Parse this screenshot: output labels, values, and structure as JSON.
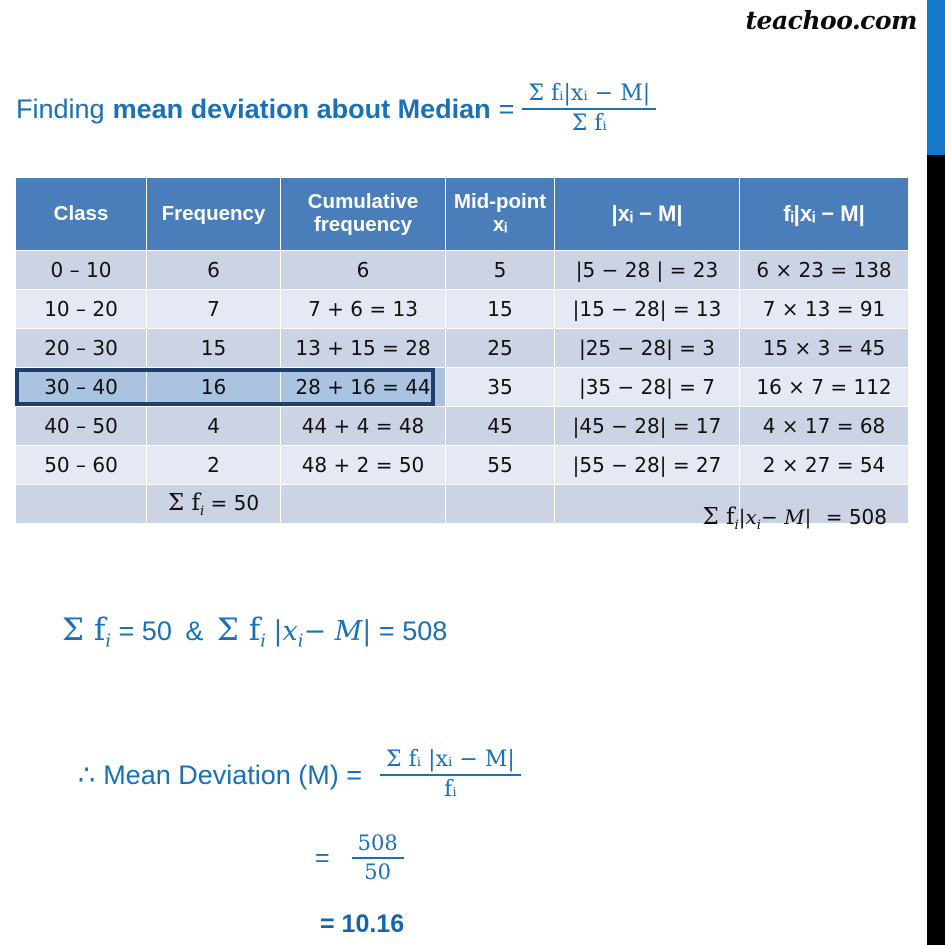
{
  "brand": "teachoo.com",
  "title": {
    "prefix": "Finding",
    "emphasis": "mean deviation about Median",
    "equals": "=",
    "formula_numerator": "Σ fᵢ|xᵢ − M|",
    "formula_denominator": "Σ fᵢ"
  },
  "table": {
    "headers": [
      "Class",
      "Frequency",
      "Cumulative frequency",
      "Mid-point xᵢ",
      "|xᵢ − M|",
      "fᵢ|xᵢ − M|"
    ],
    "rows": [
      {
        "class": "0 – 10",
        "frequency": "6",
        "cumulative": "6",
        "midpoint": "5",
        "deviation": "|5 − 28 | = 23",
        "product": "6 × 23 = 138",
        "highlighted": false
      },
      {
        "class": "10 – 20",
        "frequency": "7",
        "cumulative": "7 + 6 = 13",
        "midpoint": "15",
        "deviation": "|15 − 28| = 13",
        "product": "7 × 13 = 91",
        "highlighted": false
      },
      {
        "class": "20 – 30",
        "frequency": "15",
        "cumulative": "13 + 15 = 28",
        "midpoint": "25",
        "deviation": "|25 − 28| = 3",
        "product": "15 × 3 = 45",
        "highlighted": false
      },
      {
        "class": "30 – 40",
        "frequency": "16",
        "cumulative": "28 + 16 = 44",
        "midpoint": "35",
        "deviation": "|35 − 28| = 7",
        "product": "16   × 7 = 112",
        "highlighted": true
      },
      {
        "class": "40 – 50",
        "frequency": "4",
        "cumulative": "44 + 4 = 48",
        "midpoint": "45",
        "deviation": "|45 − 28| = 17",
        "product": "4 × 17 = 68",
        "highlighted": false
      },
      {
        "class": "50 – 60",
        "frequency": "2",
        "cumulative": "48 + 2 = 50",
        "midpoint": "55",
        "deviation": "|55 − 28| = 27",
        "product": "2 × 27 = 54",
        "highlighted": false
      }
    ],
    "totals": {
      "sum_frequency_label": "Σ f",
      "sum_frequency_sub": "i",
      "sum_frequency_value": "= 50",
      "sum_product_label": "Σ f",
      "sum_product_sub": "i",
      "sum_product_expr": "|x",
      "sum_product_sub2": "i",
      "sum_product_expr2": "− M|",
      "sum_product_value": "= 508"
    }
  },
  "equations": {
    "line1": {
      "sum_f": "Σ f",
      "sub_i": "i",
      "eq1": "=  50",
      "amp": "&",
      "sum_f2": "Σ f",
      "sub_i2": "i",
      "abs_open": "|x",
      "sub_i3": "i",
      "abs_rest": "− M|",
      "eq2": "= 508"
    },
    "line2": {
      "therefore": "∴",
      "label": "Mean Deviation (M)  =",
      "numerator": "Σ  fᵢ |xᵢ − M|",
      "denominator": "fᵢ"
    },
    "line3": {
      "equals": "=",
      "numerator": "508",
      "denominator": "50"
    },
    "line4": "= 10.16"
  },
  "colors": {
    "accent_blue": "#1971b8",
    "header_blue": "#4a7ebb",
    "row_dark": "#ccd3e4",
    "row_light": "#e5e9f3",
    "highlight_fill": "#a9c3e0",
    "highlight_border": "#1f3f68",
    "edge_blue": "#1479c8",
    "edge_black": "#000000"
  }
}
